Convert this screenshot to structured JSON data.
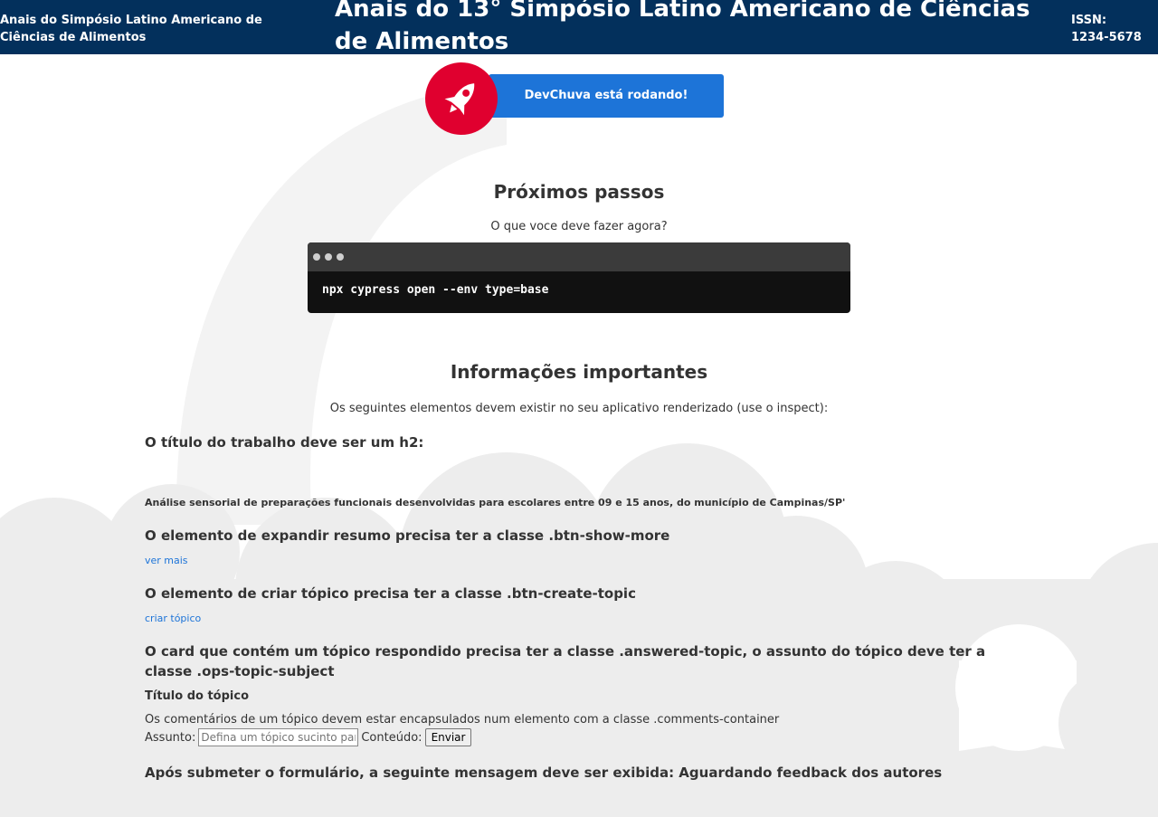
{
  "header": {
    "left_title": "Anais do Simpósio Latino Americano de Ciências de Alimentos",
    "title": "Anais do 13° Simpósio Latino Americano de Ciências de Alimentos",
    "issn": "ISSN: 1234-5678"
  },
  "banner": {
    "text": "DevChuva está rodando!",
    "icon": "rocket-icon",
    "colors": {
      "banner": "#1d74d8",
      "circle": "#e0002f"
    }
  },
  "next_steps": {
    "title": "Próximos passos",
    "subtitle": "O que voce deve fazer agora?",
    "command": "npx cypress open --env type=base"
  },
  "info": {
    "title": "Informações importantes",
    "subtitle": "Os seguintes elementos devem existir no seu aplicativo renderizado (use o inspect):"
  },
  "requirements": {
    "h2_heading": "O título do trabalho deve ser um h2:",
    "paper_title": "Análise sensorial de preparações funcionais desenvolvidas para escolares entre 09 e 15 anos, do município de Campinas/SP'",
    "show_more_heading": "O elemento de expandir resumo precisa ter a classe .btn-show-more",
    "show_more_link": "ver mais",
    "create_topic_heading": "O elemento de criar tópico precisa ter a classe .btn-create-topic",
    "create_topic_link": "criar tópico",
    "answered_heading": "O card que contém um tópico respondido precisa ter a classe .answered-topic, o assunto do tópico deve ter a classe .ops-topic-subject",
    "topic_title": "Título do tópico",
    "comments_text": "Os comentários de um tópico devem estar encapsulados num elemento com a classe .comments-container",
    "form": {
      "subject_label": "Assunto:",
      "subject_placeholder": "Defina um tópico sucinto para notificar os autores",
      "content_label": "Conteúdo:",
      "submit_label": "Enviar"
    },
    "final_heading": "Após submeter o formulário, a seguinte mensagem deve ser exibida: Aguardando feedback dos autores"
  },
  "colors": {
    "header_bg": "#03305c",
    "link": "#1d74d8",
    "terminal_bg": "#111111",
    "terminal_bar": "#3b3b3b",
    "cloud": "#ededed"
  }
}
